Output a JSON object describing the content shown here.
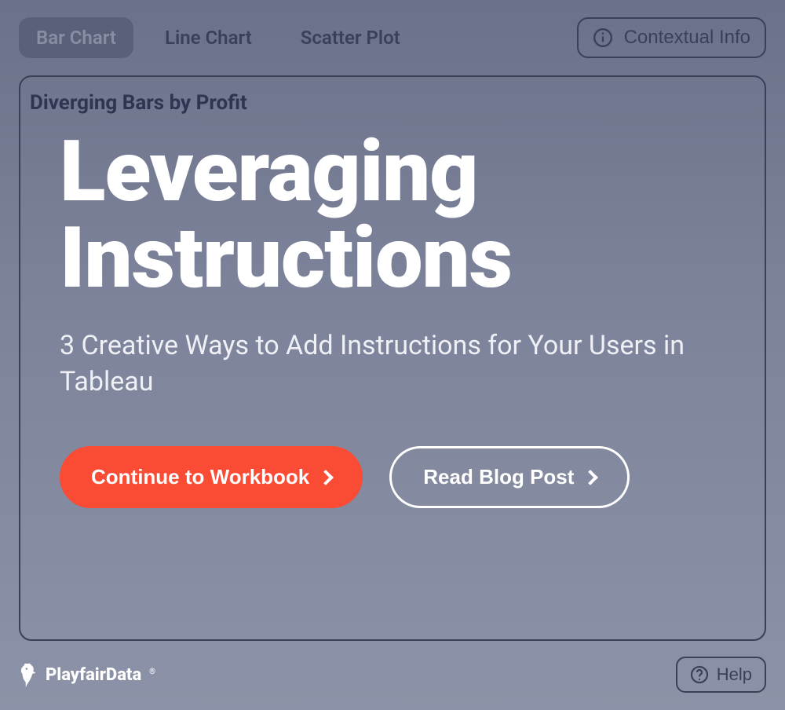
{
  "tabs": {
    "items": [
      {
        "label": "Bar Chart",
        "active": true
      },
      {
        "label": "Line Chart",
        "active": false
      },
      {
        "label": "Scatter Plot",
        "active": false
      }
    ],
    "info_label": "Contextual Info"
  },
  "card": {
    "title": "Diverging Bars by Profit",
    "hero": "Leveraging Instructions",
    "sub": "3 Creative Ways to Add Instructions for Your Users in Tableau",
    "primary_button": "Continue to Workbook",
    "secondary_button": "Read Blog Post"
  },
  "footer": {
    "brand": "PlayfairData",
    "help": "Help"
  },
  "colors": {
    "accent": "#fa4b34"
  }
}
